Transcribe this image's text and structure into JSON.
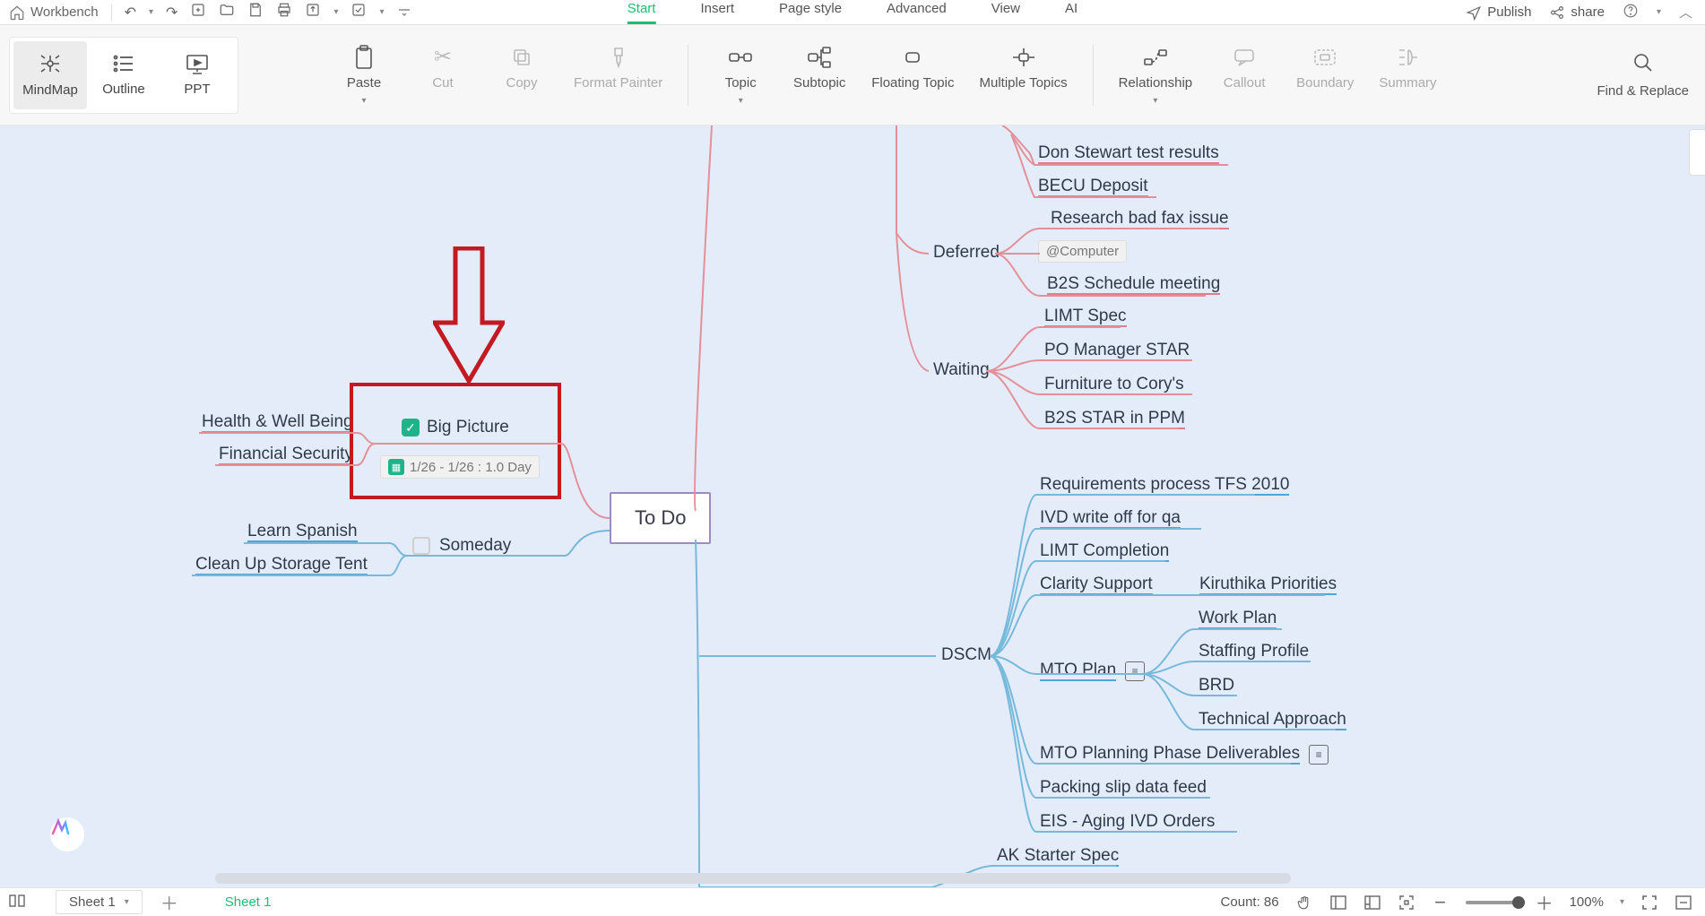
{
  "titlebar": {
    "workbench": "Workbench",
    "menus": [
      "Start",
      "Insert",
      "Page style",
      "Advanced",
      "View",
      "AI"
    ],
    "publish": "Publish",
    "share": "share"
  },
  "ribbon": {
    "views": {
      "mindmap": "MindMap",
      "outline": "Outline",
      "ppt": "PPT"
    },
    "paste": "Paste",
    "cut": "Cut",
    "copy": "Copy",
    "format_painter": "Format Painter",
    "topic": "Topic",
    "subtopic": "Subtopic",
    "floating": "Floating Topic",
    "multiple": "Multiple Topics",
    "relationship": "Relationship",
    "callout": "Callout",
    "boundary": "Boundary",
    "summary": "Summary",
    "find": "Find & Replace"
  },
  "mindmap": {
    "central": "To Do",
    "big_picture": {
      "label": "Big Picture",
      "date": "1/26 - 1/26 : 1.0 Day"
    },
    "left_hw": "Health & Well Being",
    "left_fs": "Financial Security",
    "someday": "Someday",
    "learn_spanish": "Learn Spanish",
    "storage": "Clean Up Storage Tent",
    "don_stewart": "Don Stewart test results",
    "becu": "BECU Deposit",
    "deferred": "Deferred",
    "research_fax": "Research bad fax issue",
    "at_computer": "@Computer",
    "b2s_schedule": "B2S Schedule meeting",
    "waiting": "Waiting",
    "limt_spec": "LIMT Spec",
    "po_manager": "PO Manager STAR",
    "furniture": "Furniture to Cory's",
    "b2s_star": "B2S STAR in PPM",
    "dscm": "DSCM",
    "req_tfs": "Requirements process TFS 2010",
    "ivd_write": "IVD write off for qa",
    "limt_comp": "LIMT Completion",
    "clarity": "Clarity Support",
    "kiruthika": "Kiruthika Priorities",
    "mto_plan": "MTO Plan",
    "work_plan": "Work Plan",
    "staffing": "Staffing Profile",
    "brd": "BRD",
    "tech_app": "Technical Approach",
    "mto_deliv": "MTO Planning Phase Deliverables",
    "packing": "Packing slip data feed",
    "eis": "EIS - Aging IVD Orders",
    "ak_starter": "AK Starter Spec"
  },
  "statusbar": {
    "sheet_sel": "Sheet 1",
    "sheet_active": "Sheet 1",
    "count_label": "Count: 86",
    "zoom": "100%"
  },
  "colors": {
    "red_branch": "#e27d87",
    "blue_branch": "#4aa7d6",
    "green": "#1bbf73",
    "highlight_red": "#c31923",
    "canvas": "#e5ecf9"
  }
}
